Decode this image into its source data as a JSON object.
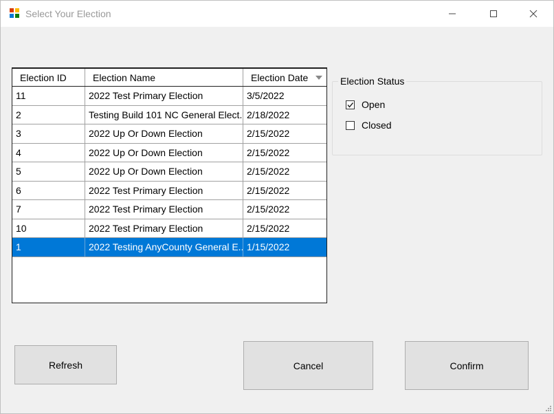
{
  "window": {
    "title": "Select Your Election"
  },
  "grid": {
    "columns": [
      "Election ID",
      "Election Name",
      "Election Date"
    ],
    "rows": [
      {
        "id": "11",
        "name": "2022 Test Primary Election",
        "date": "3/5/2022"
      },
      {
        "id": "2",
        "name": "Testing Build 101 NC General Elect...",
        "date": "2/18/2022"
      },
      {
        "id": "3",
        "name": "2022 Up Or Down Election",
        "date": "2/15/2022"
      },
      {
        "id": "4",
        "name": "2022 Up Or Down Election",
        "date": "2/15/2022"
      },
      {
        "id": "5",
        "name": "2022 Up Or Down Election",
        "date": "2/15/2022"
      },
      {
        "id": "6",
        "name": "2022 Test Primary Election",
        "date": "2/15/2022"
      },
      {
        "id": "7",
        "name": "2022 Test Primary Election",
        "date": "2/15/2022"
      },
      {
        "id": "10",
        "name": "2022 Test Primary Election",
        "date": "2/15/2022"
      },
      {
        "id": "1",
        "name": "2022 Testing AnyCounty General E...",
        "date": "1/15/2022",
        "selected": true
      }
    ]
  },
  "status": {
    "label": "Election Status",
    "options": [
      {
        "label": "Open",
        "checked": true
      },
      {
        "label": "Closed",
        "checked": false
      }
    ]
  },
  "buttons": {
    "refresh": "Refresh",
    "cancel": "Cancel",
    "confirm": "Confirm"
  },
  "colors": {
    "selection": "#0078d7",
    "button_face": "#e1e1e1"
  }
}
